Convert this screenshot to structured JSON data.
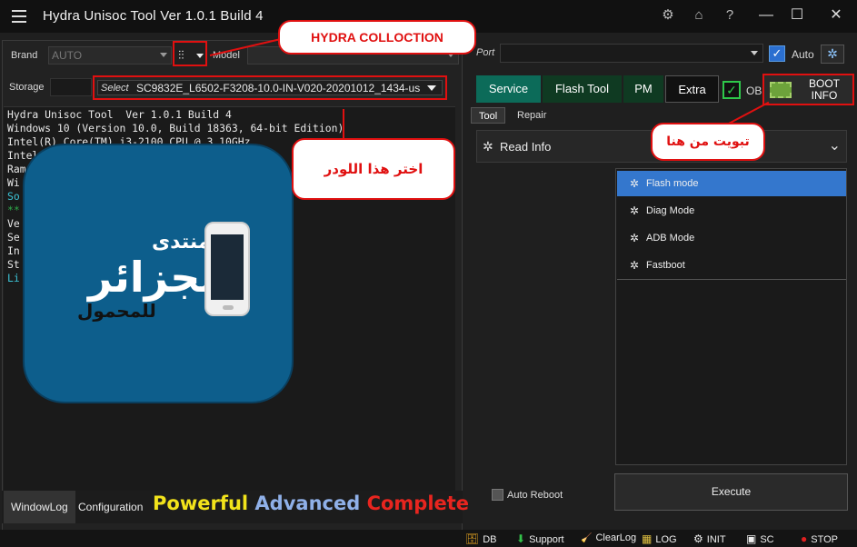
{
  "window": {
    "title": "Hydra Unisoc Tool  Ver 1.0.1 Build 4",
    "icons": [
      "gear-icon",
      "home-icon",
      "help-icon"
    ],
    "controls": {
      "minimize": "—",
      "maximize": "☐",
      "close": "✕"
    }
  },
  "left": {
    "brand_label": "Brand",
    "brand_value": "AUTO",
    "model_label": "Model",
    "storage_label": "Storage",
    "select_tag": "Select",
    "loader_value": "SC9832E_L6502-F3208-10.0-IN-V020-20201012_1434-us",
    "log_lines": [
      {
        "text": "Hydra Unisoc Tool  Ver 1.0.1 Build 4",
        "cls": ""
      },
      {
        "text": "Windows 10 (Version 10.0, Build 18363, 64-bit Edition)",
        "cls": ""
      },
      {
        "text": "Intel(R) Core(TM) i3-2100 CPU @ 3.10GHz",
        "cls": ""
      },
      {
        "text": "Intel",
        "cls": ""
      },
      {
        "text": "Ram",
        "cls": ""
      },
      {
        "text": "Wi",
        "cls": ""
      },
      {
        "text": "So",
        "cls": "cyan"
      },
      {
        "text": "",
        "cls": ""
      },
      {
        "text": "",
        "cls": ""
      },
      {
        "text": "**",
        "cls": "green"
      },
      {
        "text": "Ve",
        "cls": ""
      },
      {
        "text": "Se",
        "cls": ""
      },
      {
        "text": "In",
        "cls": ""
      },
      {
        "text": "St",
        "cls": ""
      },
      {
        "text": "Li",
        "cls": "cyan"
      }
    ],
    "logo": {
      "line1": "منتدى",
      "line2": "الجزائر",
      "line3": "للمحمول"
    },
    "bottom_tabs": [
      "WindowLog",
      "Configuration"
    ],
    "slogan": [
      {
        "text": "Powerful ",
        "color": "#f2e31b"
      },
      {
        "text": "Advanced ",
        "color": "#8fb0e8"
      },
      {
        "text": "Complete",
        "color": "#e8251f"
      }
    ]
  },
  "callouts": {
    "hydra": "HYDRA COLLOCTION",
    "loader": "اختر هذا اللودر",
    "boot": "تبويت من هنا"
  },
  "right": {
    "port_label": "Port",
    "auto_label": "Auto",
    "tabs": [
      "Service",
      "Flash Tool",
      "PM",
      "Extra"
    ],
    "ob_label": "OB",
    "boot_info": "BOOT INFO",
    "subtabs": [
      "Tool",
      "Repair"
    ],
    "section_title": "Read Info",
    "modes": [
      "Flash mode",
      "Diag Mode",
      "ADB Mode",
      "Fastboot"
    ],
    "active_mode": "Flash mode",
    "auto_reboot": "Auto Reboot",
    "execute": "Execute"
  },
  "statusbar": [
    {
      "icon": "db-icon",
      "glyph": "🗄",
      "label": "DB"
    },
    {
      "icon": "support-icon",
      "glyph": "⬇",
      "label": "Support"
    },
    {
      "icon": "clearlog-icon",
      "glyph": "🧹",
      "label": "ClearLog"
    },
    {
      "icon": "log-icon",
      "glyph": "▦",
      "label": "LOG"
    },
    {
      "icon": "init-icon",
      "glyph": "⚙",
      "label": "INIT"
    },
    {
      "icon": "screenshot-icon",
      "glyph": "▣",
      "label": "SC"
    },
    {
      "icon": "stop-icon",
      "glyph": "●",
      "label": "STOP"
    }
  ]
}
